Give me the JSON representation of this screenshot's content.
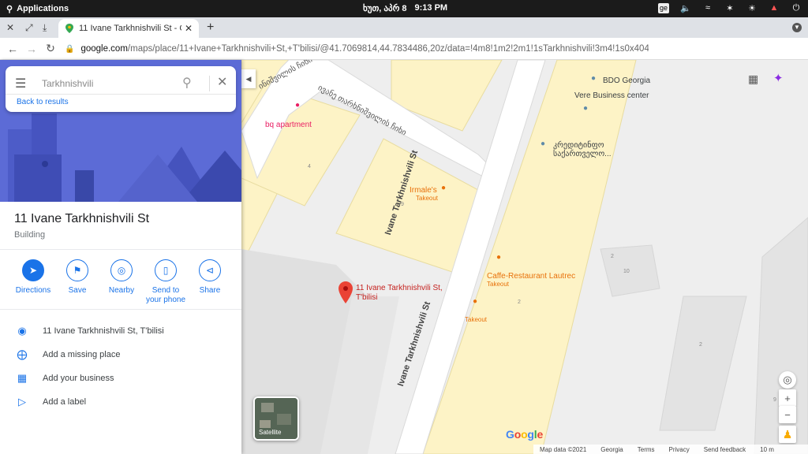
{
  "system_bar": {
    "applications": "Applications",
    "date": "ხუთ, აპრ  8",
    "time": "9:13 PM",
    "lang": "ge"
  },
  "browser": {
    "tab_title": "11 Ivane Tarkhnishvili St - Goog",
    "url_host": "google.com",
    "url_path": "/maps/place/11+Ivane+Tarkhnishvili+St,+T'bilisi/@41.7069814,44.7834486,20z/data=!4m8!1m2!2m1!1sTarkhnishvili!3m4!1s0x404..."
  },
  "search": {
    "value": "Tarkhnishvili",
    "back_label": "Back to results"
  },
  "place": {
    "title": "11 Ivane Tarkhnishvili St",
    "type": "Building"
  },
  "actions": [
    {
      "label": "Directions",
      "icon": "directions-icon"
    },
    {
      "label": "Save",
      "icon": "bookmark-icon"
    },
    {
      "label": "Nearby",
      "icon": "nearby-icon"
    },
    {
      "label": "Send to your phone",
      "icon": "send-to-phone-icon"
    },
    {
      "label": "Share",
      "icon": "share-icon"
    }
  ],
  "info": {
    "address": "11 Ivane Tarkhnishvili St, T'bilisi",
    "add_place": "Add a missing place",
    "add_business": "Add your business",
    "add_label": "Add a label"
  },
  "map": {
    "street_name": "Ivane Tarkhnishvili St",
    "street_ge": "ივანე თარხნიშვილის ჩიხი",
    "pin_label": "11 Ivane Tarkhnishvili St, T'bilisi",
    "poi": {
      "bq": "bq apartment",
      "irmale": "Irmale's",
      "irmale_sub": "Takeout",
      "bdo": "BDO Georgia",
      "vere": "Vere Business center",
      "credit": "კრედიტინფო საქართველო...",
      "caffe": "Caffe-Restaurant Lautrec",
      "caffe_sub": "Takeout",
      "takeout": "Takeout"
    },
    "building_numbers": [
      "4",
      "9",
      "2",
      "10",
      "2",
      "2",
      "9"
    ],
    "satellite_label": "Satellite",
    "logo": "Google",
    "footer": [
      "Map data ©2021",
      "Georgia",
      "Terms",
      "Privacy",
      "Send feedback",
      "10 m"
    ]
  },
  "colors": {
    "accent": "#1a73e8",
    "pin": "#ea4335",
    "poi_orange": "#e8710a",
    "poi_pink": "#e91e63",
    "poi_blue": "#5f8ba8",
    "building_yellow": "#fdf3c6"
  }
}
